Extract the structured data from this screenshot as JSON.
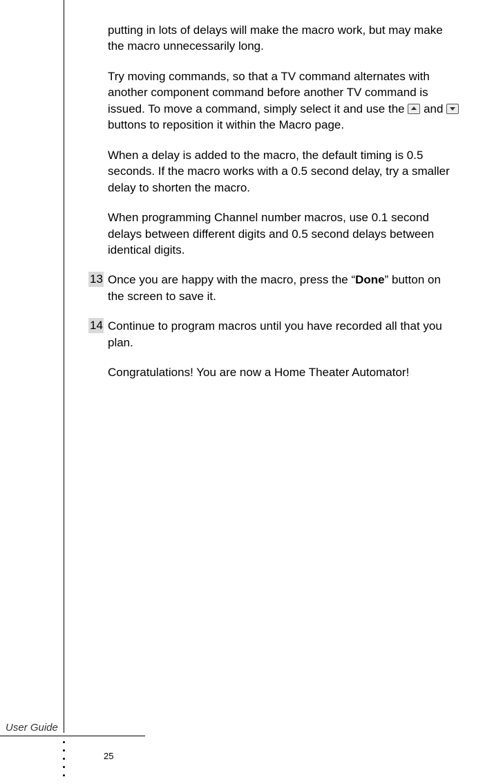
{
  "para1": "putting in lots of delays will make the macro work, but may make the macro unnecessarily long.",
  "para2a": "Try moving commands, so that a TV command alternates with another component command before another TV command is issued. To move a command, simply select it and use the ",
  "para2b": " and ",
  "para2c": "  buttons to reposition it within the Macro page.",
  "para3": "When a delay is added to the macro, the default timing is 0.5 seconds. If the macro works with a 0.5 second delay, try a smaller delay to shorten the macro.",
  "para4": "When programming Channel number macros, use 0.1 second delays between different digits and 0.5 second delays between identical digits.",
  "step13_num": "13",
  "step13a": "Once you are happy with the macro, press the “",
  "step13b": "Done",
  "step13c": "” button on the screen to save it.",
  "step14_num": "14",
  "step14": "Continue to program macros until you have recorded all that you plan.",
  "para5": "Congratulations! You are now a Home Theater Automator!",
  "footer_label": "User Guide",
  "page_number": "25"
}
